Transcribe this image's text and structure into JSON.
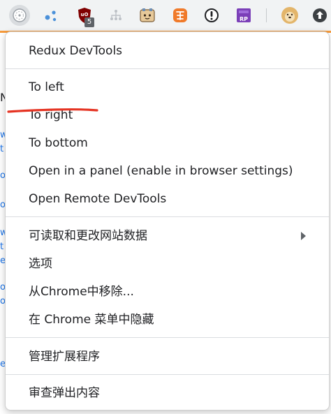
{
  "toolbar": {
    "extensions": [
      {
        "icon": "redux-devtools-icon"
      },
      {
        "icon": "dots-extension-icon"
      },
      {
        "icon": "ublock-origin-icon",
        "badge": "5"
      },
      {
        "icon": "network-tree-icon"
      },
      {
        "icon": "robot-face-icon"
      },
      {
        "icon": "orange-tag-icon"
      },
      {
        "icon": "info-circle-icon"
      },
      {
        "icon": "rp-extension-icon",
        "text": "RP"
      },
      {
        "icon": "doge-avatar-icon"
      },
      {
        "icon": "upload-arrow-icon"
      }
    ],
    "accent_color": "#f79b3b"
  },
  "menu": {
    "title": "Redux DevTools",
    "items": [
      {
        "label": "To left"
      },
      {
        "label": "To right"
      },
      {
        "label": "To bottom"
      },
      {
        "label": "Open in a panel (enable in browser settings)"
      },
      {
        "label": "Open Remote DevTools"
      }
    ],
    "chrome_items": [
      {
        "label": "可读取和更改网站数据",
        "has_submenu": true
      },
      {
        "label": "选项"
      },
      {
        "label": "从Chrome中移除..."
      },
      {
        "label": "在 Chrome 菜单中隐藏"
      }
    ],
    "manage_label": "管理扩展程序",
    "inspect_label": "审查弹出内容"
  },
  "annotation": {
    "color": "#e53322"
  }
}
